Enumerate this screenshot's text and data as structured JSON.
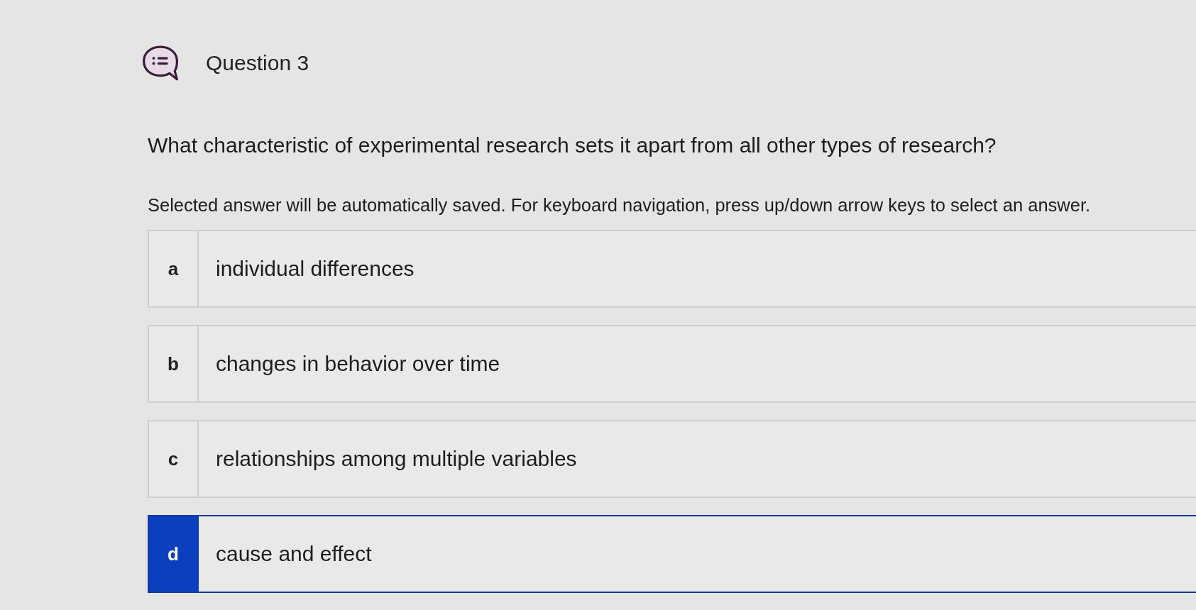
{
  "question": {
    "title": "Question 3",
    "prompt": "What characteristic of experimental research sets it apart from all other types of research?",
    "instruction": "Selected answer will be automatically saved. For keyboard navigation, press up/down arrow keys to select an answer."
  },
  "options": [
    {
      "letter": "a",
      "text": "individual differences",
      "selected": false
    },
    {
      "letter": "b",
      "text": "changes in behavior over time",
      "selected": false
    },
    {
      "letter": "c",
      "text": "relationships among multiple variables",
      "selected": false
    },
    {
      "letter": "d",
      "text": "cause and effect",
      "selected": true
    }
  ]
}
